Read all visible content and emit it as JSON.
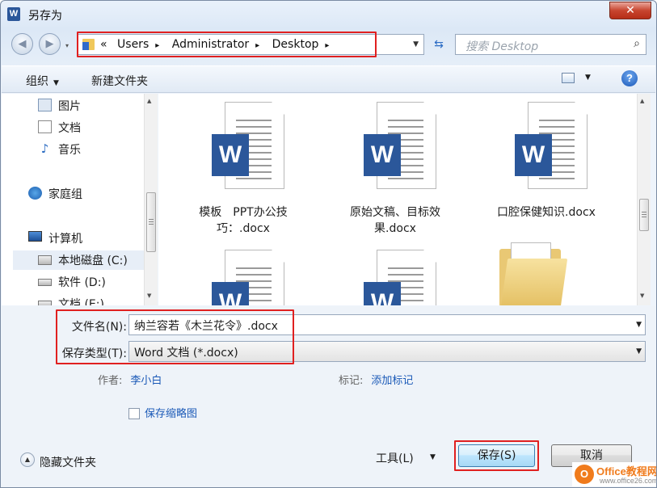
{
  "window": {
    "title": "另存为",
    "app_icon": "W"
  },
  "titlebar": {
    "close_glyph": "✕"
  },
  "nav": {
    "back_glyph": "◀",
    "forward_glyph": "▶",
    "history_glyph": "▾"
  },
  "address": {
    "overflow": "«",
    "crumbs": [
      "Users",
      "Administrator",
      "Desktop"
    ],
    "separator": "▸",
    "dropdown_glyph": "▼"
  },
  "refresh_glyph": "⇆",
  "search": {
    "placeholder": "搜索 Desktop",
    "icon_glyph": "⌕"
  },
  "toolbar": {
    "organize": "组织",
    "organize_arrow": "▼",
    "new_folder": "新建文件夹",
    "view_arrow": "▼",
    "help": "?"
  },
  "nav_items": [
    {
      "label": "图片",
      "icon": "pictures-icon"
    },
    {
      "label": "文档",
      "icon": "documents-icon"
    },
    {
      "label": "音乐",
      "icon": "music-icon"
    },
    {
      "label": "家庭组",
      "icon": "homegroup-icon"
    },
    {
      "label": "计算机",
      "icon": "computer-icon"
    },
    {
      "label": "本地磁盘 (C:)",
      "icon": "local-disk-icon"
    },
    {
      "label": "软件 (D:)",
      "icon": "drive-icon"
    },
    {
      "label": "文档 (E:)",
      "icon": "drive-icon"
    }
  ],
  "scroll": {
    "up": "▲",
    "down": "▼"
  },
  "files": [
    {
      "name_line1": "模板　PPT办公技",
      "name_line2": "巧：.docx",
      "type": "word"
    },
    {
      "name_line1": "原始文稿、目标效",
      "name_line2": "果.docx",
      "type": "word"
    },
    {
      "name_line1": "口腔保健知识.docx",
      "name_line2": "",
      "type": "word"
    },
    {
      "name_line1": "",
      "name_line2": "",
      "type": "word"
    },
    {
      "name_line1": "",
      "name_line2": "",
      "type": "word"
    },
    {
      "name_line1": "",
      "name_line2": "",
      "type": "folder"
    }
  ],
  "word_badge": "W",
  "form": {
    "filename_label": "文件名(N):",
    "filename_value": "纳兰容若《木兰花令》.docx",
    "filetype_label": "保存类型(T):",
    "filetype_value": "Word 文档 (*.docx)",
    "dropdown_glyph": "▼"
  },
  "meta": {
    "author_label": "作者:",
    "author_value": "李小白",
    "tags_label": "标记:",
    "tags_value": "添加标记"
  },
  "thumbnail": {
    "label": "保存缩略图",
    "checked": false
  },
  "footer": {
    "hide_folders": "隐藏文件夹",
    "hide_icon": "▲",
    "tools": "工具(L)",
    "tools_arrow": "▼",
    "save": "保存(S)",
    "cancel": "取消"
  },
  "watermark": {
    "logo": "O",
    "line1": "Office教程网",
    "line2": "www.office26.com"
  },
  "colors": {
    "accent": "#2b579a",
    "link": "#1a59b7",
    "highlight": "#e02020",
    "close": "#c8452f"
  }
}
